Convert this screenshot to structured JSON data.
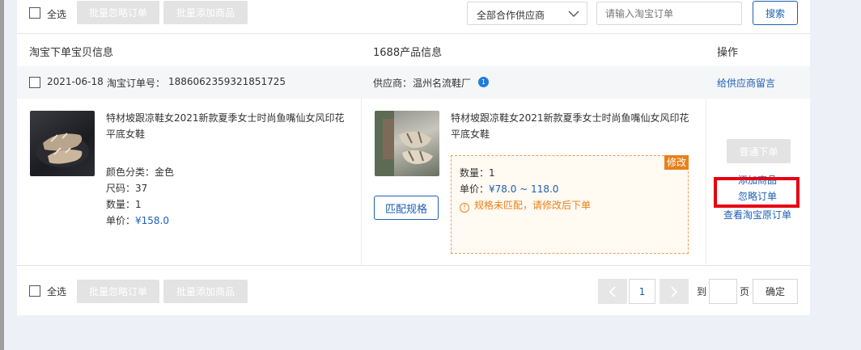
{
  "toolbar": {
    "select_all": "全选",
    "batch_ignore": "批量忽略订单",
    "batch_add": "批量添加商品",
    "supplier_select": "全部合作供应商",
    "order_search_placeholder": "请输入淘宝订单",
    "search_button": "搜索"
  },
  "columns": {
    "taobao_info": "淘宝下单宝贝信息",
    "ali1688_info": "1688产品信息",
    "actions": "操作"
  },
  "order": {
    "date": "2021-06-18",
    "order_no_label": "淘宝订单号：",
    "order_no": "1886062359321851725",
    "supplier_label": "供应商：",
    "supplier_name": "温州名流鞋厂",
    "supplier_badge": "1",
    "message_link": "给供应商留言"
  },
  "taobao_item": {
    "title": "特材坡跟凉鞋女2021新款夏季女士时尚鱼嘴仙女风印花平底女鞋",
    "color": "颜色分类：金色",
    "size": "尺码：37",
    "quantity": "数量：1",
    "price_label": "单价：",
    "price": "¥158.0"
  },
  "ali_item": {
    "title": "特材坡跟凉鞋女2021新款夏季女士时尚鱼嘴仙女风印花平底女鞋",
    "edit_tag": "修改",
    "quantity": "数量：1",
    "price_label": "单价：",
    "price": "¥78.0 ~ 118.0",
    "warning_icon": "info-circle-icon",
    "warning": "规格未匹配，请修改后下单",
    "match_spec_button": "匹配规格"
  },
  "actions": {
    "normal_order": "普通下单",
    "add_product": "添加商品",
    "ignore_order": "忽略订单",
    "view_original": "查看淘宝原订单"
  },
  "pagination": {
    "prev_icon": "chevron-left-icon",
    "current_page": "1",
    "next_icon": "chevron-right-icon",
    "to_label": "到",
    "page_label": "页",
    "confirm": "确定"
  },
  "colors": {
    "accent": "#1d5fb4",
    "warning": "#e8801b",
    "highlight": "#e60012"
  }
}
